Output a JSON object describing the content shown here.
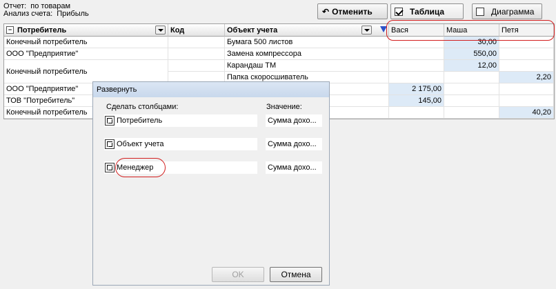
{
  "info": {
    "line1": "Отчет:  по товарам",
    "line2": "Анализ счета:  Прибыль"
  },
  "toolbar": {
    "cancel_label": "Отменить",
    "table_label": "Таблица",
    "chart_label": "Диаграмма"
  },
  "grid": {
    "headers": {
      "consumer": "Потребитель",
      "code": "Код",
      "object": "Объект учета",
      "vasya": "Вася",
      "masha": "Маша",
      "petya": "Петя"
    },
    "rows": [
      {
        "consumer": "Конечный потребитель",
        "object": "Бумага 500 листов",
        "vasya": "",
        "masha": "30,00",
        "petya": ""
      },
      {
        "consumer": "ООО \"Предприятие\"",
        "object": "Замена компрессора",
        "vasya": "",
        "masha": "550,00",
        "petya": ""
      },
      {
        "consumer": "Конечный потребитель",
        "object": "Карандаш ТМ",
        "vasya": "",
        "masha": "12,00",
        "petya": ""
      },
      {
        "consumer": "",
        "object": "Папка скоросшиватель",
        "vasya": "",
        "masha": "",
        "petya": "2,20"
      },
      {
        "consumer": "ООО \"Предприятие\"",
        "object": "",
        "vasya": "2 175,00",
        "masha": "",
        "petya": ""
      },
      {
        "consumer": "ТОВ \"Потребитель\"",
        "object": "",
        "vasya": "145,00",
        "masha": "",
        "petya": ""
      },
      {
        "consumer": "Конечный потребитель",
        "object": "",
        "vasya": "",
        "masha": "",
        "petya": "40,20"
      }
    ]
  },
  "dialog": {
    "title": "Развернуть",
    "columns_label": "Сделать столбцами:",
    "value_label": "Значение:",
    "fields": [
      {
        "name": "Потребитель",
        "value": "Сумма дохо..."
      },
      {
        "name": "Объект учета",
        "value": "Сумма дохо..."
      },
      {
        "name": "Менеджер",
        "value": "Сумма дохо..."
      }
    ],
    "ok_label": "OK",
    "cancel_label": "Отмена"
  },
  "colors": {
    "highlight_cell": "#ddeaf7",
    "annotation_red": "#d21d1d"
  }
}
